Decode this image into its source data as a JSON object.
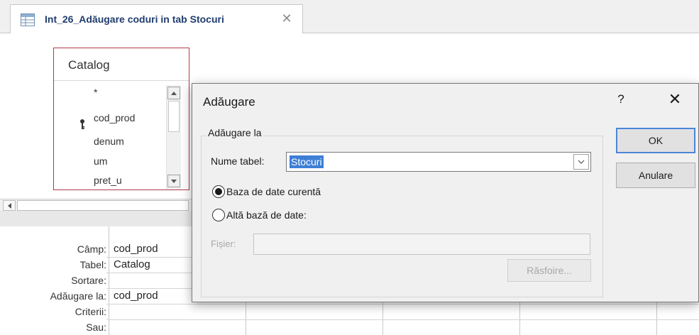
{
  "tab": {
    "title": "Int_26_Adăugare coduri in tab Stocuri",
    "icon": "query-design-icon",
    "close_glyph": "✕"
  },
  "table": {
    "name": "Catalog",
    "fields": [
      "*",
      "cod_prod",
      "denum",
      "um",
      "pret_u"
    ],
    "key_field": "cod_prod"
  },
  "grid": {
    "row_labels": [
      "Câmp:",
      "Tabel:",
      "Sortare:",
      "Adăugare la:",
      "Criterii:",
      "Sau:"
    ],
    "column1": {
      "field": "cod_prod",
      "table": "Catalog",
      "append_to": "cod_prod"
    }
  },
  "dialog": {
    "title": "Adăugare",
    "help_label": "?",
    "close_glyph": "✕",
    "group_label": "Adăugare la",
    "table_name_label": "Nume tabel:",
    "table_name_value": "Stocuri",
    "radio_current": "Baza de date curentă",
    "radio_other": "Altă bază de date:",
    "file_label": "Fișier:",
    "browse_label": "Răsfoire...",
    "ok_label": "OK",
    "cancel_label": "Anulare"
  },
  "colors": {
    "accent": "#3e7fd6",
    "table_border": "#b33a4a",
    "tab_text": "#1f3d6e"
  }
}
